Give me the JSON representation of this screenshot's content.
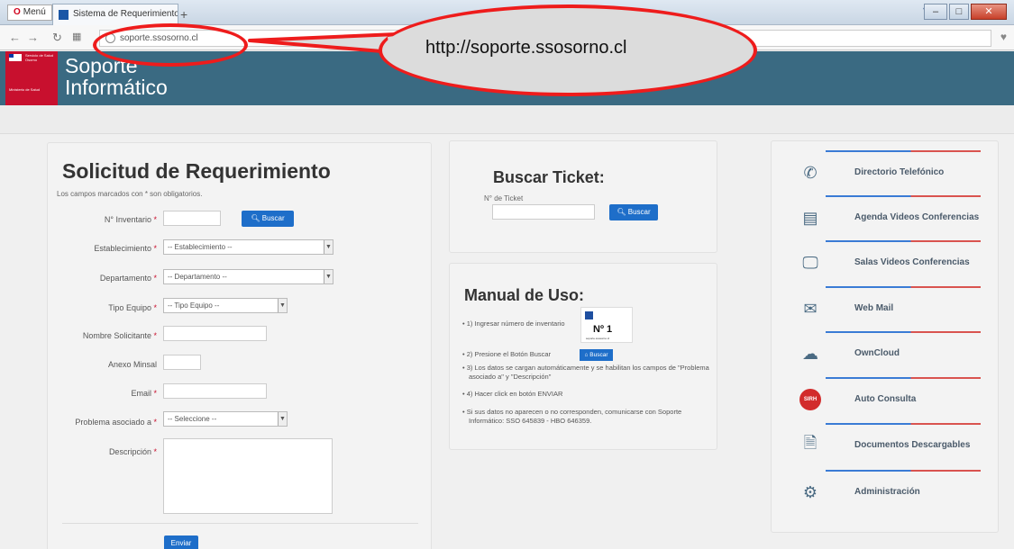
{
  "browser": {
    "menu_label": "Menú",
    "tab_title": "Sistema de Requerimientos",
    "url": "soporte.ssosorno.cl",
    "window_controls": [
      "minimize-icon",
      "restore-icon",
      "close-icon"
    ]
  },
  "annotation": {
    "callout_text": "http://soporte.ssosorno.cl",
    "color": "#ee1c1c"
  },
  "site": {
    "logo_text": "Servicio de Salud Osorno",
    "logo_sub": "Ministerio de Salud",
    "title_line1": "Soporte",
    "title_line2": "Informático",
    "header_color": "#3a6a82"
  },
  "form": {
    "title": "Solicitud de Requerimiento",
    "note": "Los campos marcados con * son obligatorios.",
    "fields": {
      "inventario": {
        "label": "N° Inventario",
        "value": ""
      },
      "establecimiento": {
        "label": "Establecimiento",
        "value": "-- Establecimiento --"
      },
      "departamento": {
        "label": "Departamento",
        "value": "-- Departamento --"
      },
      "tipo_equipo": {
        "label": "Tipo Equipo",
        "value": "-- Tipo Equipo --"
      },
      "nombre": {
        "label": "Nombre Solicitante",
        "value": ""
      },
      "anexo": {
        "label": "Anexo Minsal",
        "value": ""
      },
      "email": {
        "label": "Email",
        "value": ""
      },
      "problema": {
        "label": "Problema asociado a",
        "value": "-- Seleccione --"
      },
      "descripcion": {
        "label": "Descripción",
        "value": ""
      }
    },
    "req_mark": "*",
    "buscar_label": "Buscar",
    "enviar_label": "Enviar"
  },
  "buscar_ticket": {
    "title": "Buscar Ticket:",
    "field_label": "N° de Ticket",
    "button_label": "Buscar"
  },
  "manual": {
    "title": "Manual de Uso:",
    "steps": [
      "1) Ingresar número de inventario",
      "2) Presione el Botón Buscar",
      "3) Los datos se cargan automáticamente y se habilitan los campos de \"Problema asociado a\" y \"Descripción\"",
      "4) Hacer click en botón ENVIAR",
      "Si sus datos no aparecen o no corresponden, comunicarse con Soporte Informático: SSO 645839 - HBO 646359."
    ],
    "badge_text": "Nº 1",
    "badge_small": "soporte.ssosorno.cl",
    "mini_button": "Buscar"
  },
  "sidebar": {
    "items": [
      {
        "label": "Directorio Telefónico",
        "icon": "phone-icon"
      },
      {
        "label": "Agenda Videos Conferencias",
        "icon": "calendar-icon"
      },
      {
        "label": "Salas Videos Conferencias",
        "icon": "monitor-icon"
      },
      {
        "label": "Web Mail",
        "icon": "envelope-icon"
      },
      {
        "label": "OwnCloud",
        "icon": "cloud-icon"
      },
      {
        "label": "Auto Consulta",
        "icon": "sirh-icon",
        "icon_text": "SIRH"
      },
      {
        "label": "Documentos Descargables",
        "icon": "document-download-icon"
      },
      {
        "label": "Administración",
        "icon": "gear-icon"
      }
    ]
  }
}
